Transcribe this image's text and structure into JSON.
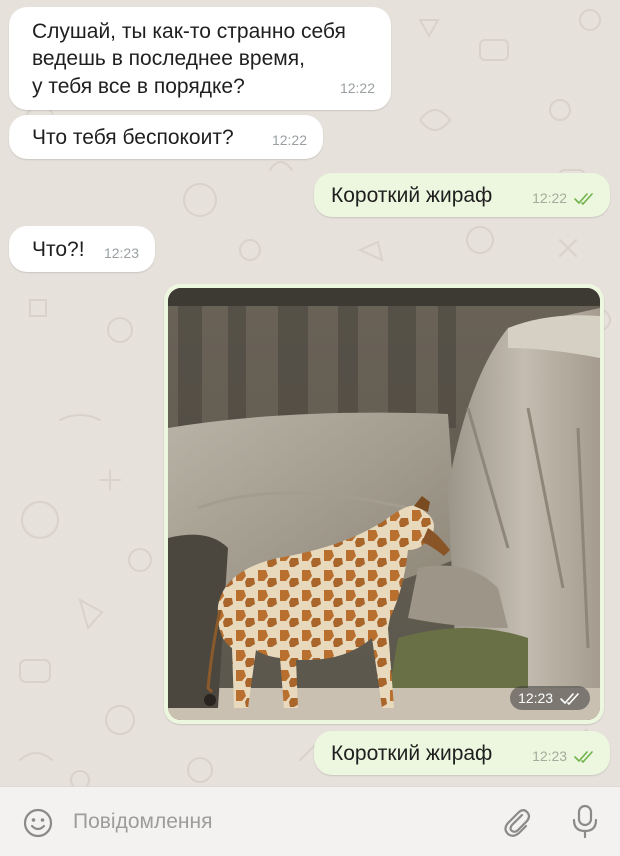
{
  "messages": [
    {
      "id": "m1",
      "direction": "incoming",
      "lines": [
        "Слушай, ты как-то странно себя",
        "ведешь в последнее время,",
        "у тебя все в порядке?"
      ],
      "time": "12:22"
    },
    {
      "id": "m2",
      "direction": "incoming",
      "lines": [
        "Что тебя беспокоит?"
      ],
      "time": "12:22"
    },
    {
      "id": "m3",
      "direction": "outgoing",
      "lines": [
        "Короткий жираф"
      ],
      "time": "12:22",
      "status": "read"
    },
    {
      "id": "m4",
      "direction": "incoming",
      "lines": [
        "Что?!"
      ],
      "time": "12:23"
    },
    {
      "id": "m5",
      "direction": "outgoing",
      "type": "photo",
      "time": "12:23",
      "status": "read"
    },
    {
      "id": "m6",
      "direction": "outgoing",
      "lines": [
        "Короткий жираф"
      ],
      "time": "12:23",
      "status": "read"
    }
  ],
  "composer": {
    "placeholder": "Повідомлення"
  },
  "icons": {
    "emoji": "emoji-icon",
    "attach": "paperclip-icon",
    "mic": "microphone-icon",
    "read": "double-check-icon"
  },
  "colors": {
    "incoming_bubble": "#ffffff",
    "outgoing_bubble": "#edf7df",
    "tick": "#6fb34a",
    "background": "#e6e1db"
  }
}
